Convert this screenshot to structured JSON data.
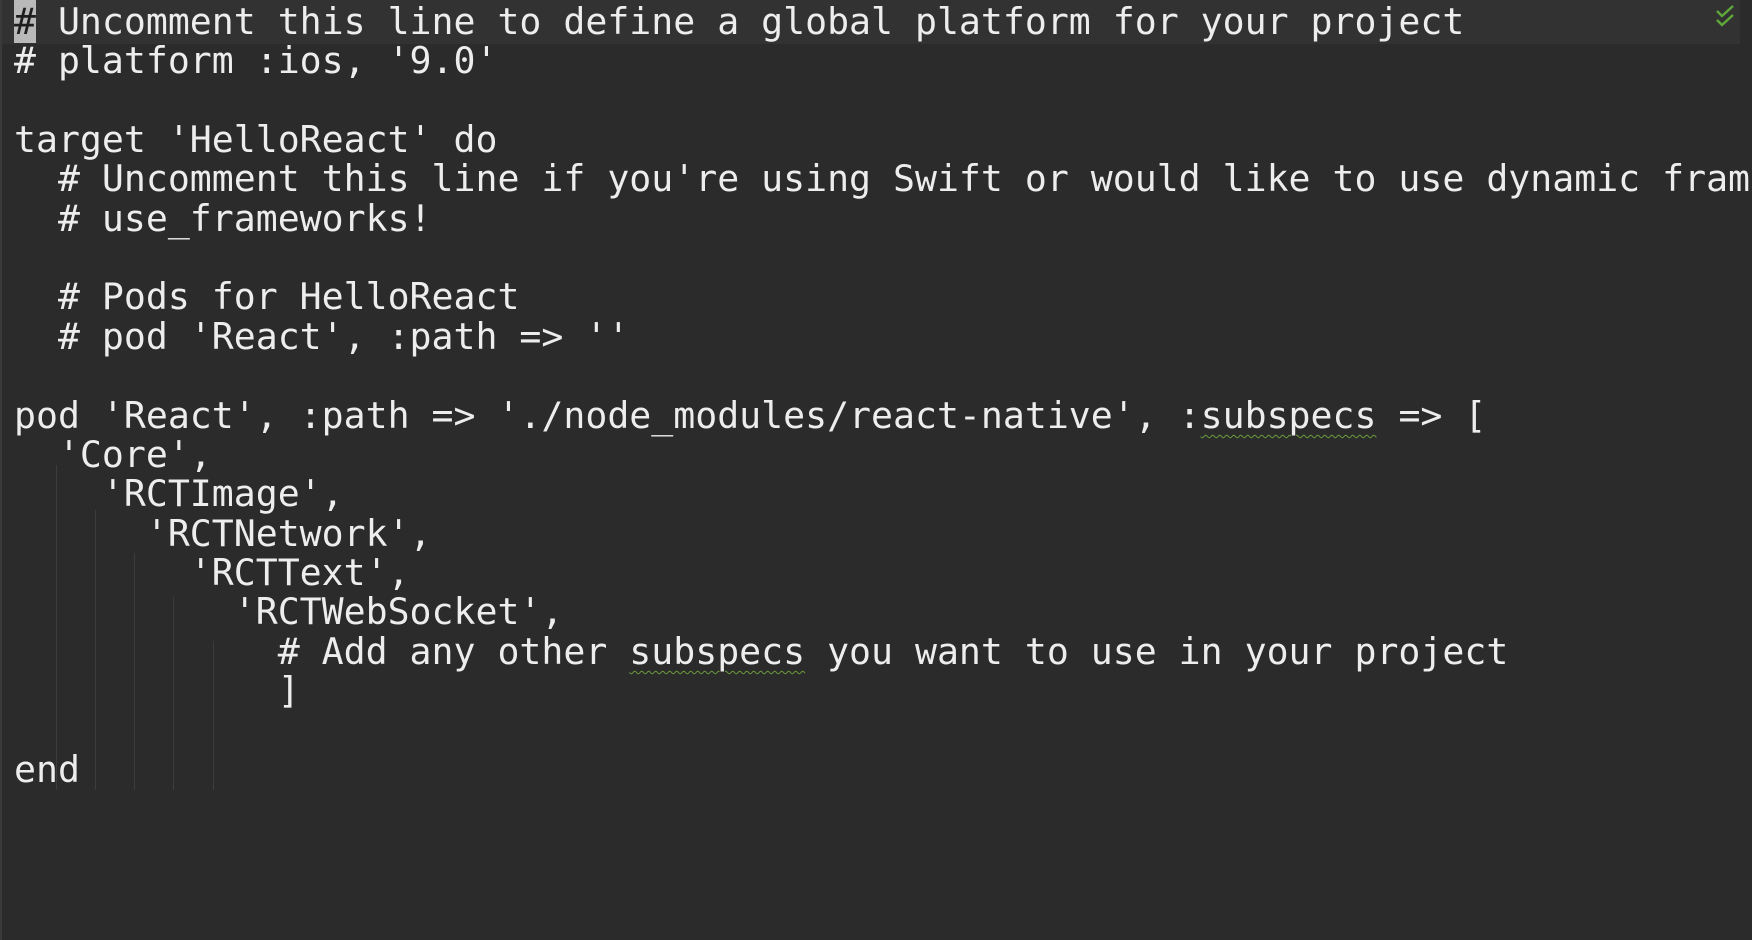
{
  "editor": {
    "lines": [
      {
        "prefix": "",
        "caret": "#",
        "text": " Uncomment this line to define a global platform for your project",
        "typo": "",
        "suffix": ""
      },
      {
        "prefix": "",
        "caret": "",
        "text": "# platform :ios, '9.0'",
        "typo": "",
        "suffix": ""
      },
      {
        "prefix": "",
        "caret": "",
        "text": "",
        "typo": "",
        "suffix": ""
      },
      {
        "prefix": "",
        "caret": "",
        "text": "target 'HelloReact' do",
        "typo": "",
        "suffix": ""
      },
      {
        "prefix": "",
        "caret": "",
        "text": "  # Uncomment this line if you're using Swift or would like to use dynamic fram",
        "typo": "",
        "suffix": ""
      },
      {
        "prefix": "",
        "caret": "",
        "text": "  # use_frameworks!",
        "typo": "",
        "suffix": ""
      },
      {
        "prefix": "",
        "caret": "",
        "text": "",
        "typo": "",
        "suffix": ""
      },
      {
        "prefix": "",
        "caret": "",
        "text": "  # Pods for HelloReact",
        "typo": "",
        "suffix": ""
      },
      {
        "prefix": "",
        "caret": "",
        "text": "  # pod 'React', :path => ''",
        "typo": "",
        "suffix": ""
      },
      {
        "prefix": "",
        "caret": "",
        "text": "",
        "typo": "",
        "suffix": ""
      },
      {
        "prefix": "",
        "caret": "",
        "text": "pod 'React', :path => './node_modules/react-native', :",
        "typo": "subspecs",
        "suffix": " => ["
      },
      {
        "prefix": "",
        "caret": "",
        "text": "  'Core',",
        "typo": "",
        "suffix": ""
      },
      {
        "prefix": "",
        "caret": "",
        "text": "    'RCTImage',",
        "typo": "",
        "suffix": ""
      },
      {
        "prefix": "",
        "caret": "",
        "text": "      'RCTNetwork',",
        "typo": "",
        "suffix": ""
      },
      {
        "prefix": "",
        "caret": "",
        "text": "        'RCTText',",
        "typo": "",
        "suffix": ""
      },
      {
        "prefix": "",
        "caret": "",
        "text": "          'RCTWebSocket',",
        "typo": "",
        "suffix": ""
      },
      {
        "prefix": "",
        "caret": "",
        "text": "            # Add any other ",
        "typo": "subspecs",
        "suffix": " you want to use in your project"
      },
      {
        "prefix": "",
        "caret": "",
        "text": "            ]",
        "typo": "",
        "suffix": ""
      },
      {
        "prefix": "",
        "caret": "",
        "text": "",
        "typo": "",
        "suffix": ""
      },
      {
        "prefix": "",
        "caret": "",
        "text": "end",
        "typo": "",
        "suffix": ""
      }
    ],
    "status_icon": "double-check-icon",
    "colors": {
      "background": "#2b2b2b",
      "text": "#ededed",
      "current_line": "#323232",
      "typo_underline": "#6a9b3a",
      "status_ok": "#5fa83a"
    }
  }
}
